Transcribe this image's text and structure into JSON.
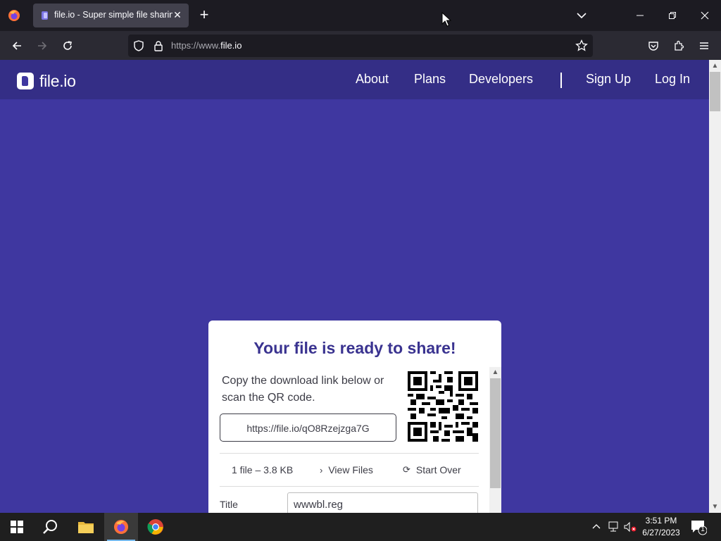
{
  "browser": {
    "tab_title": "file.io - Super simple file sharing",
    "url_prefix": "https://www.",
    "url_domain": "file.io"
  },
  "site": {
    "logo_text": "file.io",
    "nav": {
      "about": "About",
      "plans": "Plans",
      "developers": "Developers",
      "signup": "Sign Up",
      "login": "Log In"
    }
  },
  "card": {
    "title": "Your file is ready to share!",
    "desc": "Copy the download link below or scan the QR code.",
    "link": "https://file.io/qO8Rzejzga7G",
    "stat": "1 file – 3.8 KB",
    "view_files": "View Files",
    "start_over": "Start Over",
    "title_label": "Title",
    "title_value": "wwwbl.reg"
  },
  "taskbar": {
    "time": "3:51 PM",
    "date": "6/27/2023",
    "notification_count": "1"
  },
  "colors": {
    "page_bg": "#3f37a0",
    "header_bg": "#342e86",
    "card_title": "#3a3390"
  }
}
